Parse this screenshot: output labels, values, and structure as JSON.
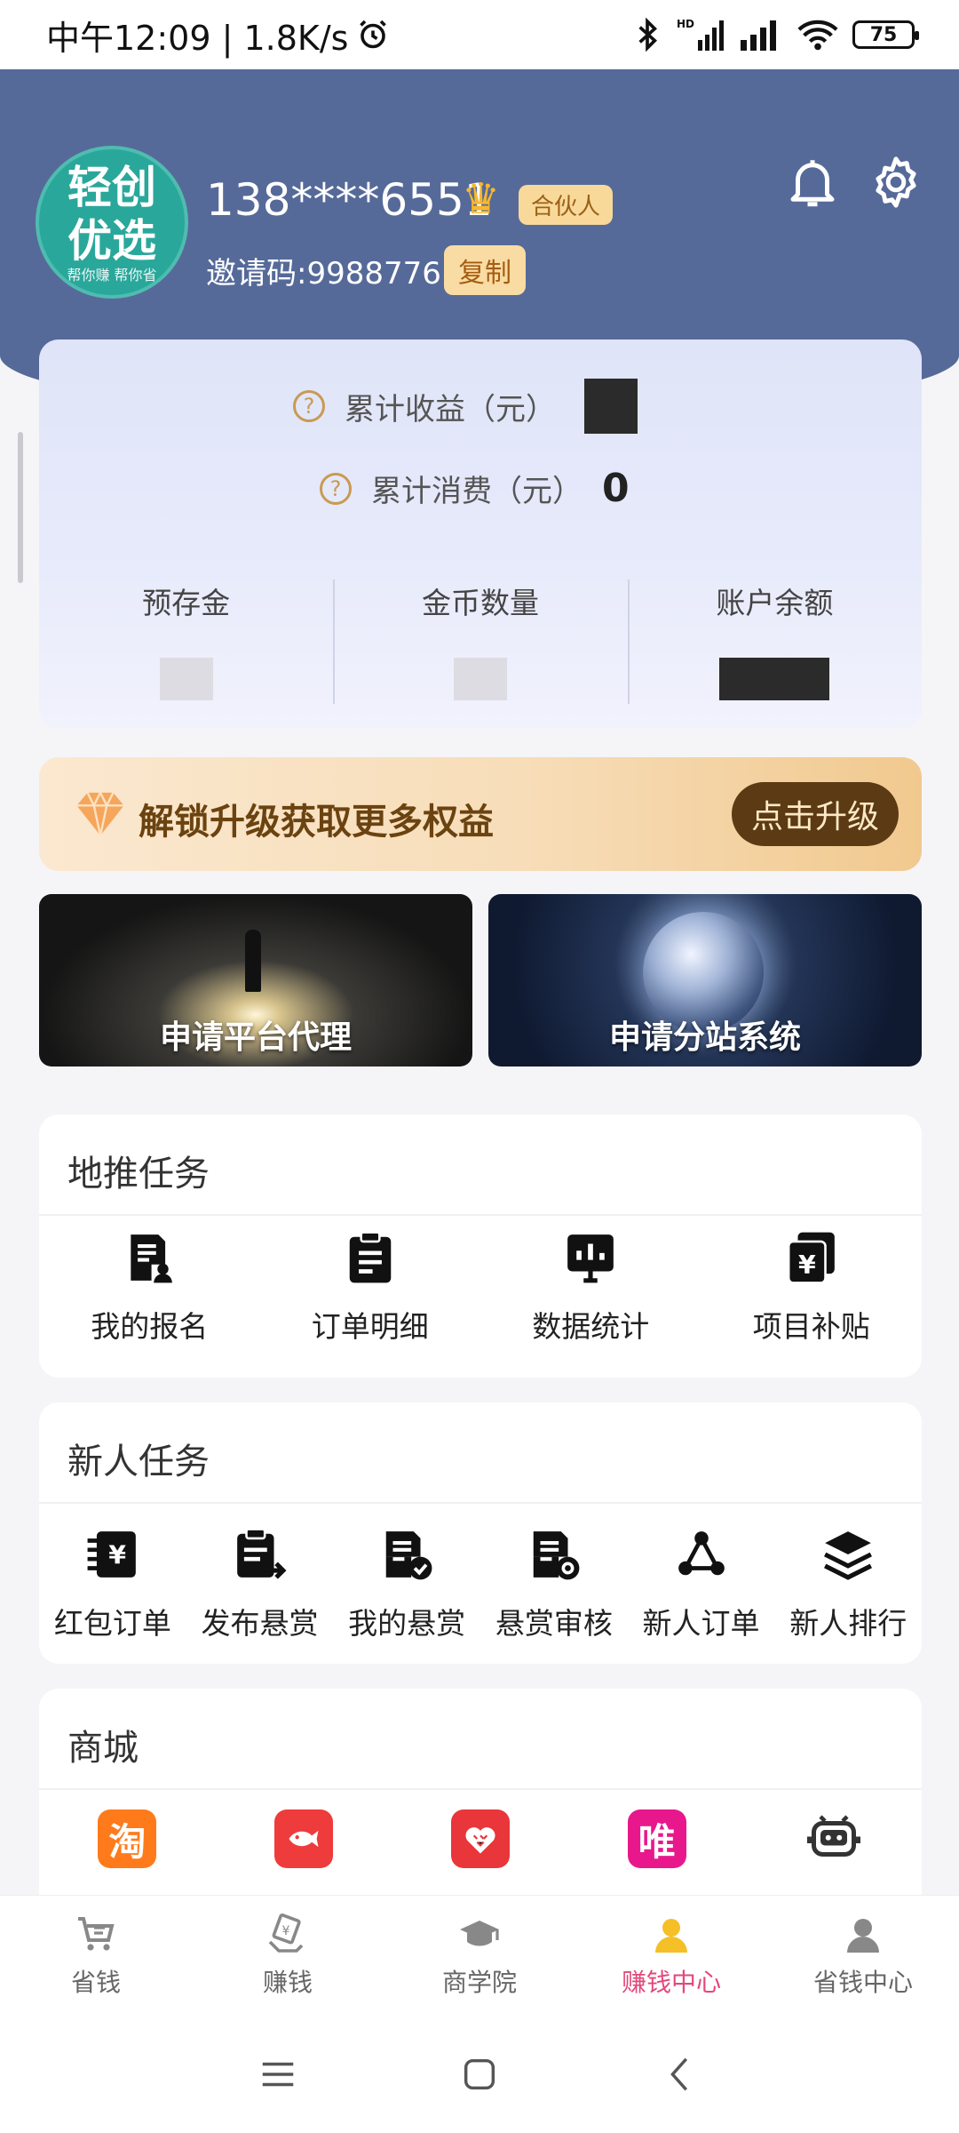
{
  "status_bar": {
    "time_label": "中午12:09 | 1.8K/s",
    "alarm_icon": "alarm-icon",
    "battery": "75",
    "hd_label": "HD"
  },
  "profile": {
    "logo_line1": "轻创",
    "logo_line2": "优选",
    "logo_slogan": "帮你赚 帮你省",
    "phone": "138****6551",
    "badge": "合伙人",
    "invite_code": "邀请码:9988776",
    "copy_label": "复制"
  },
  "stats": {
    "total_income_label": "累计收益（元）",
    "total_spend_label": "累计消费（元）",
    "total_spend_value": "0",
    "columns": [
      {
        "label": "预存金"
      },
      {
        "label": "金币数量"
      },
      {
        "label": "账户余额"
      }
    ]
  },
  "upgrade": {
    "text": "解锁升级获取更多权益",
    "button": "点击升级"
  },
  "promos": [
    {
      "label": "申请平台代理"
    },
    {
      "label": "申请分站系统"
    }
  ],
  "ground_tasks": {
    "title": "地推任务",
    "items": [
      {
        "label": "我的报名",
        "icon": "registration-doc-icon"
      },
      {
        "label": "订单明细",
        "icon": "clipboard-icon"
      },
      {
        "label": "数据统计",
        "icon": "bar-chart-icon"
      },
      {
        "label": "项目补贴",
        "icon": "yen-cards-icon"
      }
    ]
  },
  "newbie_tasks": {
    "title": "新人任务",
    "items": [
      {
        "label": "红包订单",
        "icon": "red-packet-icon"
      },
      {
        "label": "发布悬赏",
        "icon": "publish-reward-icon"
      },
      {
        "label": "我的悬赏",
        "icon": "my-reward-icon"
      },
      {
        "label": "悬赏审核",
        "icon": "review-icon"
      },
      {
        "label": "新人订单",
        "icon": "network-icon"
      },
      {
        "label": "新人排行",
        "icon": "layers-icon"
      }
    ]
  },
  "shop": {
    "title": "商城",
    "items": [
      {
        "glyph": "淘",
        "color": "#ff7a1a",
        "icon": "taobao-icon"
      },
      {
        "glyph": "",
        "color": "#ee3b3b",
        "icon": "fish-icon"
      },
      {
        "glyph": "",
        "color": "#e8363b",
        "icon": "pinduoduo-icon"
      },
      {
        "glyph": "唯",
        "color": "#e8188c",
        "icon": "vipshop-icon"
      },
      {
        "glyph": "",
        "color": "#ffffff",
        "icon": "robot-icon"
      }
    ]
  },
  "bottom_nav": [
    {
      "label": "省钱",
      "icon": "cart-icon"
    },
    {
      "label": "赚钱",
      "icon": "money-hand-icon"
    },
    {
      "label": "商学院",
      "icon": "graduation-cap-icon"
    },
    {
      "label": "赚钱中心",
      "icon": "user-icon"
    },
    {
      "label": "省钱中心",
      "icon": "user-gray-icon"
    }
  ],
  "colors": {
    "header": "#566a99",
    "active_nav": "#e3487a",
    "accent_gold": "#c99a52"
  }
}
